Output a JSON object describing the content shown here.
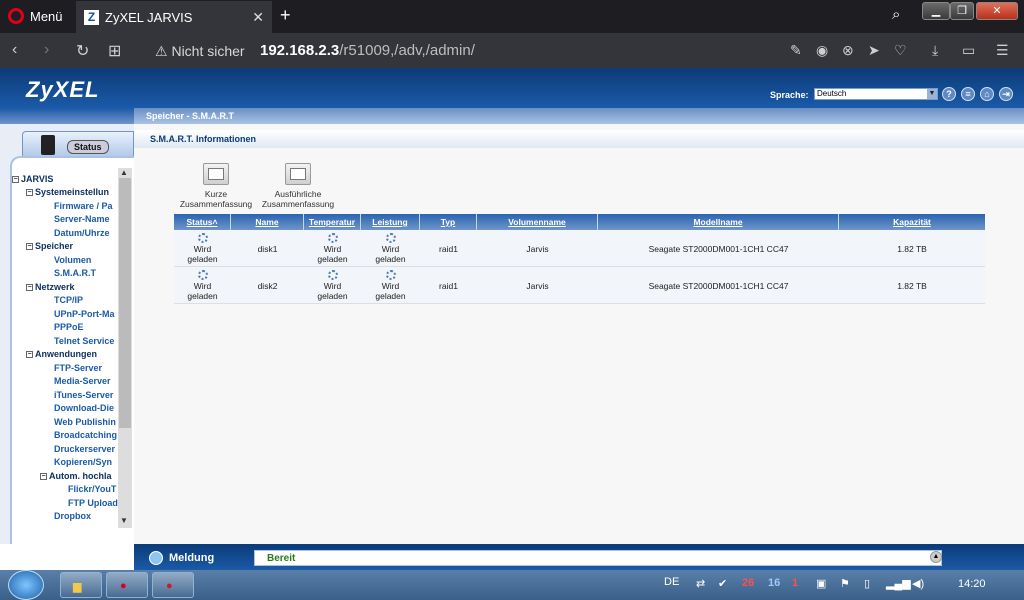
{
  "browser": {
    "menu_label": "Menü",
    "tab_title": "ZyXEL JARVIS",
    "insecure_label": "Nicht sicher",
    "url_host": "192.168.2.3",
    "url_path": "/r51009,/adv,/admin/"
  },
  "header": {
    "logo": "ZyXEL",
    "language_label": "Sprache:",
    "language_value": "Deutsch",
    "icons": [
      "help-icon",
      "info-icon",
      "home-icon",
      "logout-icon"
    ]
  },
  "sidebar": {
    "status_tab": "Status",
    "tree": [
      {
        "label": "JARVIS",
        "level": "root"
      },
      {
        "label": "Systemeinstellun",
        "level": "cat"
      },
      {
        "label": "Firmware / Pa",
        "level": "leaf"
      },
      {
        "label": "Server-Name",
        "level": "leaf"
      },
      {
        "label": "Datum/Uhrze",
        "level": "leaf"
      },
      {
        "label": "Speicher",
        "level": "cat"
      },
      {
        "label": "Volumen",
        "level": "leaf"
      },
      {
        "label": "S.M.A.R.T",
        "level": "leaf"
      },
      {
        "label": "Netzwerk",
        "level": "cat"
      },
      {
        "label": "TCP/IP",
        "level": "leaf"
      },
      {
        "label": "UPnP-Port-Ma",
        "level": "leaf"
      },
      {
        "label": "PPPoE",
        "level": "leaf"
      },
      {
        "label": "Telnet Service",
        "level": "leaf"
      },
      {
        "label": "Anwendungen",
        "level": "cat"
      },
      {
        "label": "FTP-Server",
        "level": "leaf"
      },
      {
        "label": "Media-Server",
        "level": "leaf"
      },
      {
        "label": "iTunes-Server",
        "level": "leaf"
      },
      {
        "label": "Download-Die",
        "level": "leaf"
      },
      {
        "label": "Web Publishin",
        "level": "leaf"
      },
      {
        "label": "Broadcatching",
        "level": "leaf"
      },
      {
        "label": "Druckerserver",
        "level": "leaf"
      },
      {
        "label": "Kopieren/Syn",
        "level": "leaf"
      },
      {
        "label": "Autom. hochla",
        "level": "subcat"
      },
      {
        "label": "Flickr/YouT",
        "level": "subleaf"
      },
      {
        "label": "FTP Upload",
        "level": "subleaf"
      },
      {
        "label": "Dropbox",
        "level": "leaf"
      }
    ]
  },
  "content": {
    "page_title": "Speicher - S.M.A.R.T",
    "section_title": "S.M.A.R.T. Informationen",
    "buttons": {
      "short_line1": "Kurze",
      "short_line2": "Zusammenfassung",
      "full_line1": "Ausführliche",
      "full_line2": "Zusammenfassung"
    },
    "table": {
      "headers": [
        "Status",
        "Name",
        "Temperatur",
        "Leistung",
        "Typ",
        "Volumenname",
        "Modellname",
        "Kapazität"
      ],
      "loading_line1": "Wird",
      "loading_line2": "geladen",
      "rows": [
        {
          "name": "disk1",
          "type": "raid1",
          "volume": "Jarvis",
          "model": "Seagate ST2000DM001-1CH1 CC47",
          "capacity": "1.82 TB"
        },
        {
          "name": "disk2",
          "type": "raid1",
          "volume": "Jarvis",
          "model": "Seagate ST2000DM001-1CH1 CC47",
          "capacity": "1.82 TB"
        }
      ]
    }
  },
  "statusbar": {
    "label": "Meldung",
    "message": "Bereit"
  },
  "taskbar": {
    "language": "DE",
    "tray_numbers": [
      "26",
      "16",
      "1"
    ],
    "clock": "14:20"
  }
}
